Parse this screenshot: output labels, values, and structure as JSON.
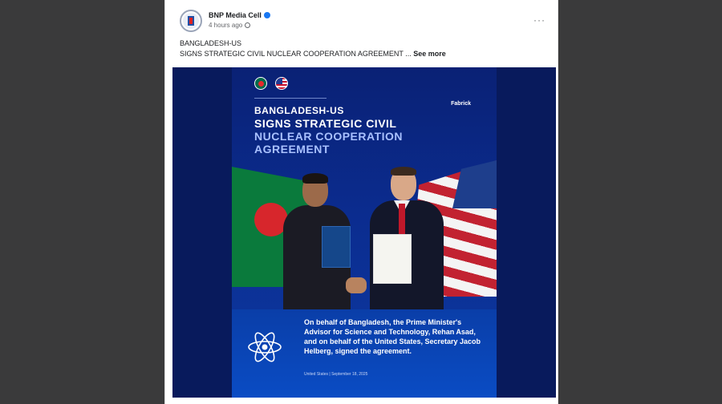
{
  "post": {
    "author": "BNP Media Cell",
    "time": "4 hours ago",
    "more_label": "···",
    "caption_line1": "BANGLADESH-US",
    "caption_line2": "SIGNS STRATEGIC CIVIL NUCLEAR COOPERATION AGREEMENT ...",
    "see_more": "See more"
  },
  "graphic": {
    "brand": "Fabrick",
    "headline_1": "BANGLADESH-US",
    "headline_2": "SIGNS STRATEGIC CIVIL",
    "headline_3": "NUCLEAR COOPERATION",
    "headline_4": "AGREEMENT",
    "body": "On behalf of Bangladesh, the Prime Minister's Advisor for Science and Technology, Rehan Asad, and on behalf of the United States, Secretary Jacob Helberg, signed the agreement.",
    "date": "United States | September 18, 2025"
  },
  "colors": {
    "accent": "#1877f2",
    "graphic_bg": "#0a2175"
  }
}
